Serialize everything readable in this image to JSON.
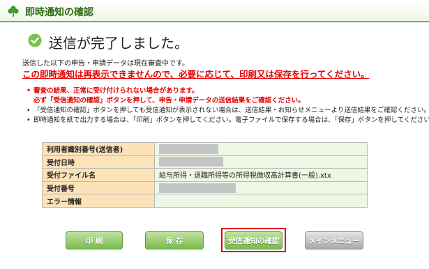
{
  "header": {
    "title": "即時通知の確認",
    "icon": "clover-icon"
  },
  "status": {
    "message": "送信が完了しました。",
    "icon": "check-circle-icon"
  },
  "intro": "送信した以下の申告・申請データは現在審査中です。",
  "warning": "この即時通知は再表示できませんので、必要に応じて、印刷又は保存を行ってください。",
  "notes": [
    {
      "line1": "審査の結果、正常に受け付けられない場合があります。",
      "line2": "必ず「受信通知の確認」ボタンを押して、申告・申請データの送信結果をご確認ください。"
    },
    {
      "text": "「受信通知の確認」ボタンを押しても受信通知が表示されない場合は、送信結果・お知らせメニューより送信結果をご確認ください。"
    },
    {
      "text": "即時通知を紙で出力する場合は、「印刷」ボタンを押してください。電子ファイルで保存する場合は、「保存」ボタンを押してください。"
    }
  ],
  "table": {
    "rows": [
      {
        "label": "利用者識別番号(送信者)",
        "value": ""
      },
      {
        "label": "受付日時",
        "value": ""
      },
      {
        "label": "受付ファイル名",
        "value": "給与所得・退職所得等の所得税徴収高計算書(一般).xtx"
      },
      {
        "label": "受付番号",
        "value": ""
      },
      {
        "label": "エラー情報",
        "value": ""
      }
    ]
  },
  "buttons": {
    "print": "印 刷",
    "save": "保 存",
    "check": "受信通知の確認",
    "menu": "メインメニュー"
  },
  "colors": {
    "accent_green": "#6eb04a",
    "warning_red": "#e60000",
    "label_bg": "#fbe2b8",
    "value_bg": "#eef7e4",
    "highlight_outline": "#e2001a"
  }
}
